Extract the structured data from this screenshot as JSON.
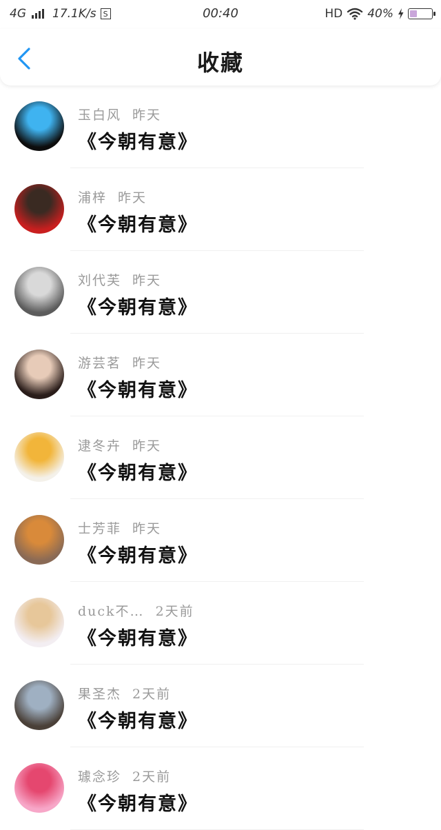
{
  "status_bar": {
    "network": "4G",
    "speed": "17.1K/s",
    "sim_label": "S",
    "time": "00:40",
    "hd": "HD",
    "battery_text": "40%",
    "battery_level": 0.4,
    "battery_color": "#c9a6da"
  },
  "header": {
    "title": "收藏",
    "back_icon": "chevron-left-icon",
    "accent": "#2196f3"
  },
  "favorites": [
    {
      "user": "玉白风",
      "time": "昨天",
      "work": "《今朝有意》",
      "avatar_colors": [
        "#0d0d0d",
        "#3fb3f0"
      ]
    },
    {
      "user": "浦梓",
      "time": "昨天",
      "work": "《今朝有意》",
      "avatar_colors": [
        "#c91f1f",
        "#3a2a22"
      ]
    },
    {
      "user": "刘代芙",
      "time": "昨天",
      "work": "《今朝有意》",
      "avatar_colors": [
        "#5c5c5c",
        "#d9d9d9"
      ]
    },
    {
      "user": "游芸茗",
      "time": "昨天",
      "work": "《今朝有意》",
      "avatar_colors": [
        "#2a1d1a",
        "#e7cbb8"
      ]
    },
    {
      "user": "逮冬卉",
      "time": "昨天",
      "work": "《今朝有意》",
      "avatar_colors": [
        "#f4f1ea",
        "#f2b53a"
      ]
    },
    {
      "user": "士芳菲",
      "time": "昨天",
      "work": "《今朝有意》",
      "avatar_colors": [
        "#8a6a55",
        "#d98a3a"
      ]
    },
    {
      "user": "duck不…",
      "time": "2天前",
      "work": "《今朝有意》",
      "avatar_colors": [
        "#f3eef2",
        "#e7c79a"
      ]
    },
    {
      "user": "果圣杰",
      "time": "2天前",
      "work": "《今朝有意》",
      "avatar_colors": [
        "#4a4038",
        "#9fb0c2"
      ]
    },
    {
      "user": "璩念珍",
      "time": "2天前",
      "work": "《今朝有意》",
      "avatar_colors": [
        "#f7a7c8",
        "#e5476f"
      ]
    }
  ]
}
